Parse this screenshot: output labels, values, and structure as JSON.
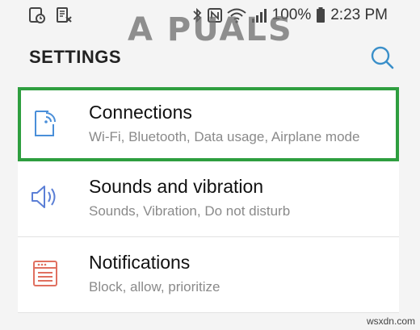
{
  "status": {
    "battery": "100%",
    "time": "2:23 PM"
  },
  "watermark": "A PUALS",
  "header": {
    "title": "SETTINGS"
  },
  "items": [
    {
      "title": "Connections",
      "subtitle": "Wi-Fi, Bluetooth, Data usage, Airplane mode",
      "icon": "connections-icon",
      "highlighted": true
    },
    {
      "title": "Sounds and vibration",
      "subtitle": "Sounds, Vibration, Do not disturb",
      "icon": "speaker-icon"
    },
    {
      "title": "Notifications",
      "subtitle": "Block, allow, prioritize",
      "icon": "notifications-icon"
    }
  ],
  "credit": "wsxdn.com",
  "colors": {
    "highlight": "#2e9e3f",
    "connections_icon": "#4a8fd9",
    "sound_icon": "#5b7fd6",
    "notification_icon": "#e07060",
    "search_icon": "#3a8fc9"
  }
}
